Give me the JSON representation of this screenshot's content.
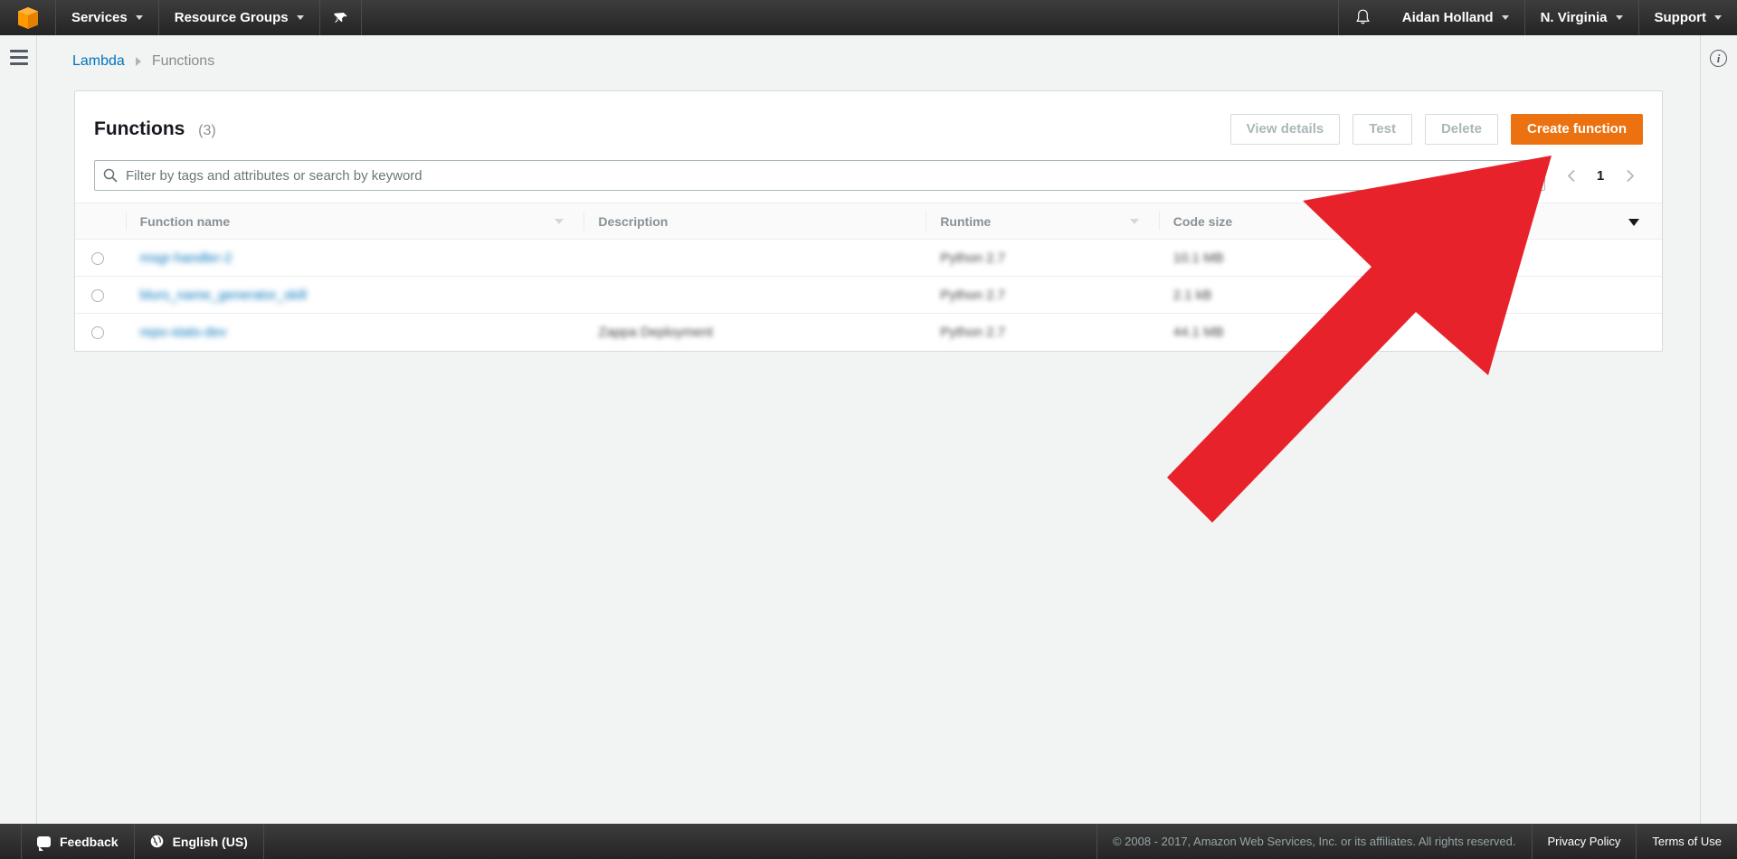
{
  "topnav": {
    "logo_icon": "aws-cube-logo",
    "services_label": "Services",
    "resource_groups_label": "Resource Groups",
    "pin_icon": "pushpin-icon",
    "bell_icon": "bell-notification-icon",
    "account_label": "Aidan Holland",
    "region_label": "N. Virginia",
    "support_label": "Support"
  },
  "rails": {
    "hamburger_icon": "hamburger-menu-icon",
    "info_icon": "info-circle-icon",
    "info_glyph": "i"
  },
  "breadcrumb": {
    "root": "Lambda",
    "current": "Functions"
  },
  "panel": {
    "title": "Functions",
    "count": "(3)",
    "buttons": {
      "view_details": "View details",
      "test": "Test",
      "delete": "Delete",
      "create_function": "Create function"
    },
    "search": {
      "icon": "search-icon",
      "placeholder": "Filter by tags and attributes or search by keyword",
      "value": "",
      "help_icon": "help-circle-icon",
      "help_glyph": "?"
    },
    "pagination": {
      "prev_icon": "chevron-left-icon",
      "next_icon": "chevron-right-icon",
      "current_page": "1"
    },
    "table": {
      "columns": [
        {
          "key": "select",
          "label": ""
        },
        {
          "key": "name",
          "label": "Function name",
          "sortable": true
        },
        {
          "key": "description",
          "label": "Description",
          "sortable": false
        },
        {
          "key": "runtime",
          "label": "Runtime",
          "sortable": true
        },
        {
          "key": "code_size",
          "label": "Code size",
          "sortable": false
        }
      ],
      "settings_icon": "caret-down-icon",
      "rows": [
        {
          "name": "msgr-handler-2",
          "description": "",
          "runtime": "Python 2.7",
          "code_size": "10.1 MB",
          "redacted": true
        },
        {
          "name": "blurs_name_generator_skill",
          "description": "",
          "runtime": "Python 2.7",
          "code_size": "2.1 kB",
          "redacted": true
        },
        {
          "name": "repo-stats-dev",
          "description": "Zappa Deployment",
          "runtime": "Python 2.7",
          "code_size": "44.1 MB",
          "redacted": true
        }
      ]
    }
  },
  "footer": {
    "feedback_label": "Feedback",
    "feedback_icon": "speech-bubble-icon",
    "language_label": "English (US)",
    "language_icon": "globe-icon",
    "copyright": "© 2008 - 2017, Amazon Web Services, Inc. or its affiliates. All rights reserved.",
    "privacy_policy": "Privacy Policy",
    "terms_of_use": "Terms of Use"
  },
  "annotation": {
    "arrow_icon": "red-arrow-annotation",
    "color": "#e8222a",
    "points_to": "help-circle-icon"
  },
  "colors": {
    "accent_orange": "#ec7211",
    "link_blue": "#0073bb",
    "nav_dark": "#242424",
    "page_bg": "#f2f3f3",
    "annotation_red": "#e8222a"
  }
}
